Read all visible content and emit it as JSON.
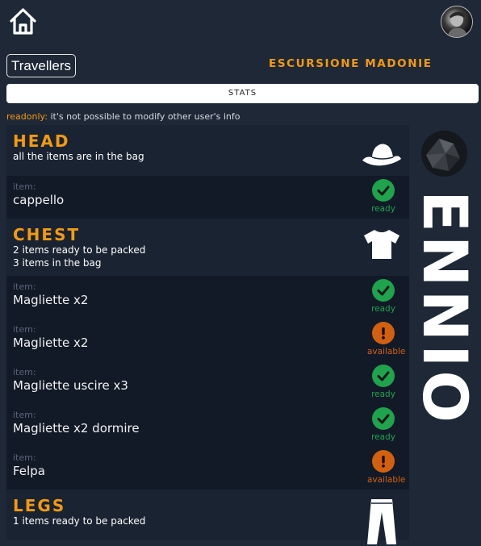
{
  "header": {
    "home_icon": "home-icon",
    "avatar_icon": "user-avatar"
  },
  "travellers_label": "Travellers",
  "trip_title": "ESCURSIONE MADONIE",
  "stats_label": "STATS",
  "readonly": {
    "tag": "readonly:",
    "message": "it's not possible to modify other user's info"
  },
  "user": {
    "name": "ENNIO"
  },
  "status_labels": {
    "ready": "ready",
    "available": "available"
  },
  "colors": {
    "accent": "#f39a12",
    "ready": "#1fa34d",
    "available": "#d2600f",
    "background": "#1f2836"
  },
  "sections": [
    {
      "title": "HEAD",
      "icon": "hat-icon",
      "lines": [
        "all the items are in the bag"
      ],
      "items": [
        {
          "label": "item:",
          "name": "cappello",
          "status": "ready",
          "status_text": "ready"
        }
      ]
    },
    {
      "title": "CHEST",
      "icon": "tshirt-icon",
      "lines": [
        "2 items ready to be packed",
        "3 items in the bag"
      ],
      "items": [
        {
          "label": "item:",
          "name": "Magliette x2",
          "status": "ready",
          "status_text": "ready"
        },
        {
          "label": "item:",
          "name": "Magliette x2",
          "status": "available",
          "status_text": "available"
        },
        {
          "label": "item:",
          "name": "Magliette uscire x3",
          "status": "ready",
          "status_text": "ready"
        },
        {
          "label": "item:",
          "name": "Magliette x2 dormire",
          "status": "ready",
          "status_text": "ready"
        },
        {
          "label": "item:",
          "name": "Felpa",
          "status": "available",
          "status_text": "available"
        }
      ]
    },
    {
      "title": "LEGS",
      "icon": "trousers-icon",
      "lines": [
        "1 items ready to be packed"
      ],
      "items": []
    }
  ]
}
